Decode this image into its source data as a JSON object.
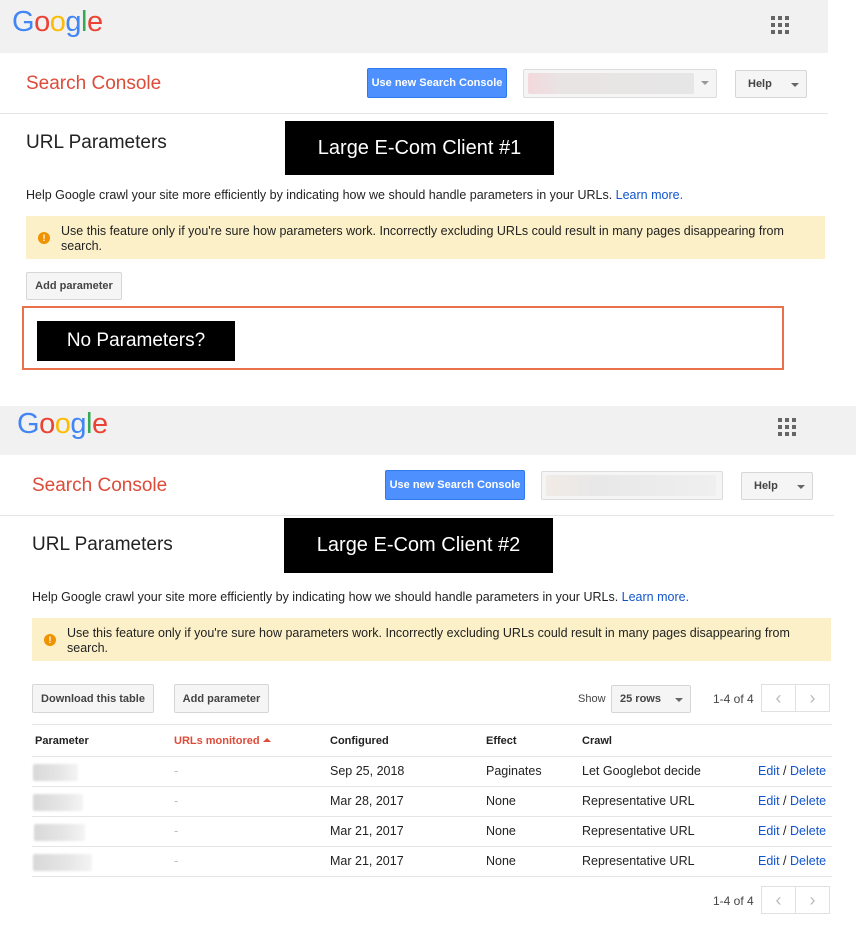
{
  "colors": {
    "google_blue": "#4285f4",
    "google_red": "#ea4335",
    "google_yellow": "#fbbc05",
    "google_green": "#34a853",
    "accent_red": "#dd4b39",
    "link": "#1155cc",
    "warning_bg": "#fcf0c8",
    "outline": "#e8704a"
  },
  "panel1": {
    "logo": [
      "G",
      "o",
      "o",
      "g",
      "l",
      "e"
    ],
    "apps_icon": "apps-grid-icon",
    "title": "Search Console",
    "new_console_button": "Use new Search Console",
    "help_button": "Help",
    "heading": "URL Parameters",
    "client_label": "Large E-Com Client #1",
    "help_text": "Help Google crawl your site more efficiently by indicating how we should handle parameters in your URLs.",
    "learn_more": "Learn more.",
    "warning_icon": "warning-circle-icon",
    "warning": "Use this feature only if you're sure how parameters work. Incorrectly excluding URLs could result in many pages disappearing from search.",
    "add_parameter": "Add parameter",
    "no_params_label": "No Parameters?"
  },
  "panel2": {
    "logo": [
      "G",
      "o",
      "o",
      "g",
      "l",
      "e"
    ],
    "apps_icon": "apps-grid-icon",
    "title": "Search Console",
    "new_console_button": "Use new Search Console",
    "help_button": "Help",
    "heading": "URL Parameters",
    "client_label": "Large E-Com Client #2",
    "help_text": "Help Google crawl your site more efficiently by indicating how we should handle parameters in your URLs.",
    "learn_more": "Learn more.",
    "warning_icon": "warning-circle-icon",
    "warning": "Use this feature only if you're sure how parameters work. Incorrectly excluding URLs could result in many pages disappearing from search.",
    "download_button": "Download this table",
    "add_parameter": "Add parameter",
    "show_label": "Show",
    "rows_value": "25 rows",
    "pager_text": "1-4 of 4",
    "prev_icon": "chevron-left-icon",
    "next_icon": "chevron-right-icon",
    "columns": {
      "parameter": "Parameter",
      "urls_monitored": "URLs monitored",
      "configured": "Configured",
      "effect": "Effect",
      "crawl": "Crawl"
    },
    "rows": [
      {
        "urls": "-",
        "configured": "Sep 25, 2018",
        "effect": "Paginates",
        "crawl": "Let Googlebot decide",
        "edit": "Edit",
        "sep": "/",
        "delete": "Delete"
      },
      {
        "urls": "-",
        "configured": "Mar 28, 2017",
        "effect": "None",
        "crawl": "Representative URL",
        "edit": "Edit",
        "sep": "/",
        "delete": "Delete"
      },
      {
        "urls": "-",
        "configured": "Mar 21, 2017",
        "effect": "None",
        "crawl": "Representative URL",
        "edit": "Edit",
        "sep": "/",
        "delete": "Delete"
      },
      {
        "urls": "-",
        "configured": "Mar 21, 2017",
        "effect": "None",
        "crawl": "Representative URL",
        "edit": "Edit",
        "sep": "/",
        "delete": "Delete"
      }
    ],
    "pager_bottom_text": "1-4 of 4"
  }
}
